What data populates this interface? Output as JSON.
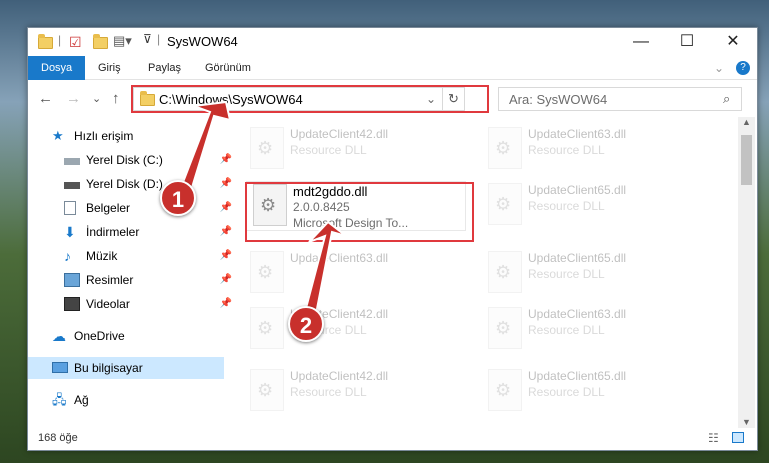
{
  "window": {
    "title": "SysWOW64",
    "minimize": "—",
    "maximize": "☐",
    "close": "✕"
  },
  "ribbon": {
    "tabs": [
      "Dosya",
      "Giriş",
      "Paylaş",
      "Görünüm"
    ]
  },
  "nav": {
    "back": "←",
    "forward": "→",
    "recent": "⌄",
    "up": "↑",
    "address": "C:\\Windows\\SysWOW64",
    "dropdown": "⌄",
    "refresh": "↻",
    "search_placeholder": "Ara: SysWOW64"
  },
  "sidebar": {
    "quick_access": "Hızlı erişim",
    "items": [
      {
        "label": "Yerel Disk (C:)",
        "icon": "drive-icon"
      },
      {
        "label": "Yerel Disk (D:)",
        "icon": "drive-icon"
      },
      {
        "label": "Belgeler",
        "icon": "documents-icon"
      },
      {
        "label": "İndirmeler",
        "icon": "downloads-icon"
      },
      {
        "label": "Müzik",
        "icon": "music-icon"
      },
      {
        "label": "Resimler",
        "icon": "pictures-icon"
      },
      {
        "label": "Videolar",
        "icon": "videos-icon"
      }
    ],
    "onedrive": "OneDrive",
    "this_pc": "Bu bilgisayar",
    "network": "Ağ"
  },
  "files": {
    "bg": [
      {
        "name": "UpdateClient42.dll",
        "desc": "Resource DLL"
      },
      {
        "name": "UpdateClient63.dll",
        "desc": "Resource DLL"
      },
      {
        "name": "UpdateClient65.dll",
        "desc": "Resource DLL"
      },
      {
        "name": "UpdateClient63.dll",
        "desc": ""
      },
      {
        "name": "UpdateClient65.dll",
        "desc": "Resource DLL"
      },
      {
        "name": "UpdateClient42.dll",
        "desc": "Resource DLL"
      },
      {
        "name": "UpdateClient63.dll",
        "desc": "Resource DLL"
      },
      {
        "name": "UpdateClient42.dll",
        "desc": "Resource DLL"
      },
      {
        "name": "UpdateClient65.dll",
        "desc": "Resource DLL"
      }
    ],
    "selected": {
      "name": "mdt2gddo.dll",
      "version": "2.0.0.8425",
      "company": "Microsoft Design To..."
    }
  },
  "status": {
    "count": "168 öğe"
  },
  "annotations": {
    "step1": "1",
    "step2": "2"
  },
  "colors": {
    "accent": "#1979ca",
    "highlight": "#e0393e",
    "badge": "#c8302c"
  }
}
